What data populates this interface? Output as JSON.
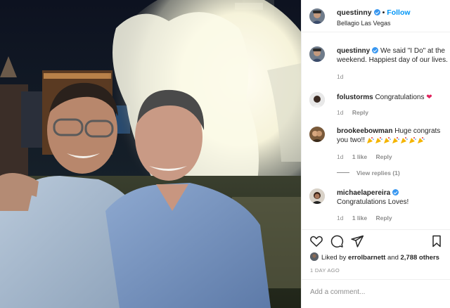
{
  "post": {
    "username": "questinny",
    "follow_label": "Follow",
    "location": "Bellagio Las Vegas"
  },
  "caption": {
    "username": "questinny",
    "text": "We said \"I Do\" at the weekend. Happiest day of our lives.",
    "time": "1d"
  },
  "comments": [
    {
      "username": "folustorms",
      "text": "Congratulations",
      "emoji": "heart",
      "time": "1d",
      "likes": "",
      "reply_label": "Reply"
    },
    {
      "username": "brookeebowman",
      "text": "Huge congrats you two!!",
      "emoji": "party-popper x7",
      "time": "1d",
      "likes": "1 like",
      "reply_label": "Reply"
    },
    {
      "username": "michaelapereira",
      "text": "Congratulations Loves!",
      "time": "1d",
      "likes": "1 like",
      "reply_label": "Reply"
    }
  ],
  "view_replies": "View replies (1)",
  "liked_by": {
    "prefix": "Liked by",
    "user": "errolbarnett",
    "joiner": "and",
    "others": "2,788 others"
  },
  "time_ago": "1 DAY AGO",
  "add_comment": {
    "placeholder": "Add a comment..."
  },
  "icons": {
    "like": "heart-outline-icon",
    "comment": "comment-bubble-icon",
    "share": "paper-plane-icon",
    "save": "bookmark-icon",
    "verified": "verified-badge-icon"
  },
  "colors": {
    "link": "#0095f6",
    "verified": "#3897f0",
    "muted": "#8e8e8e",
    "heart": "#e0245e"
  }
}
